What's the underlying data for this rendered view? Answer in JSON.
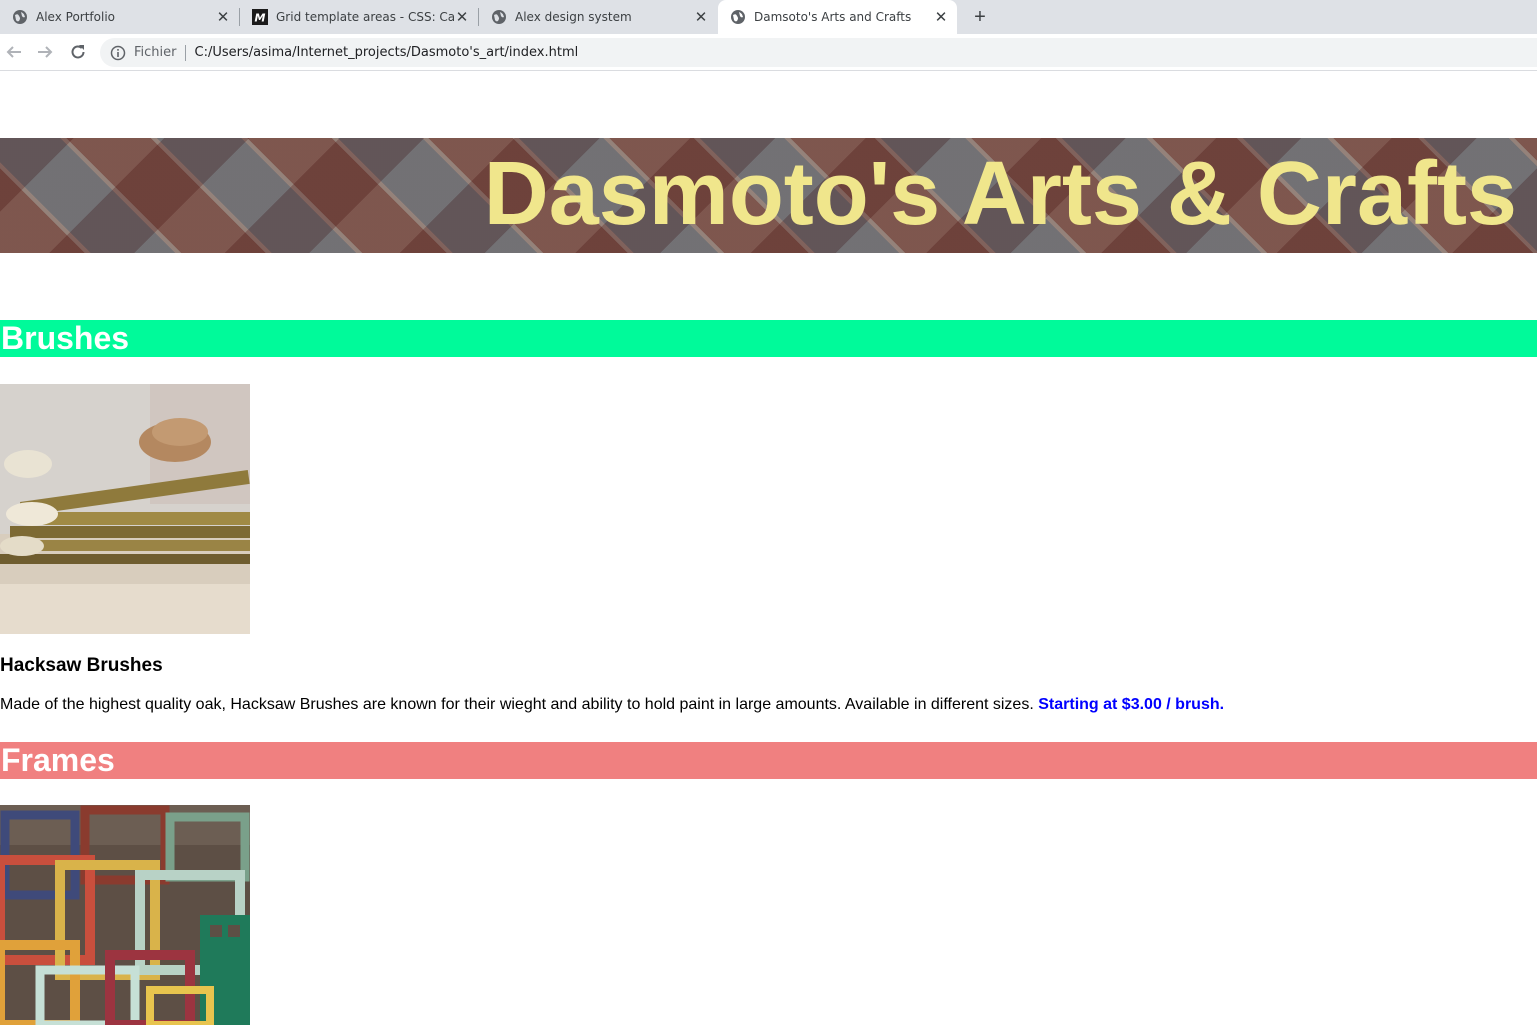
{
  "browser": {
    "tabs": [
      {
        "title": "Alex Portfolio",
        "icon": "globe-icon",
        "active": false
      },
      {
        "title": "Grid template areas - CSS: Cascading",
        "icon": "mdn-icon",
        "active": false
      },
      {
        "title": "Alex design system",
        "icon": "globe-icon",
        "active": false
      },
      {
        "title": "Damsoto's Arts and Crafts",
        "icon": "globe-icon",
        "active": true
      }
    ],
    "new_tab_label": "+",
    "address": {
      "scheme_label": "Fichier",
      "url": "C:/Users/asima/Internet_projects/Dasmoto's_art/index.html"
    }
  },
  "page": {
    "banner_title": "Dasmoto's Arts & Crafts",
    "sections": [
      {
        "heading": "Brushes",
        "color": "#00fa9a",
        "product_name": "Hacksaw Brushes",
        "description": "Made of the highest quality oak, Hacksaw Brushes are known for their wieght and ability to hold paint in large amounts. Available in different sizes.",
        "price": "Starting at $3.00 / brush."
      },
      {
        "heading": "Frames",
        "color": "#f08080"
      }
    ]
  },
  "colors": {
    "banner_text": "#f0e68c",
    "price_text": "#0000ff"
  }
}
